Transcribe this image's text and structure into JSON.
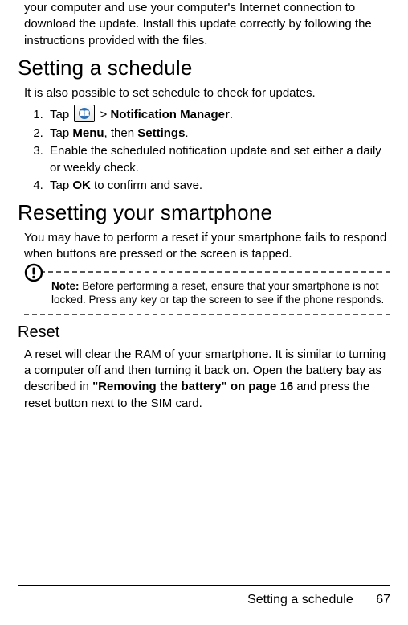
{
  "intro_continuation": "your computer and use your computer's Internet connection to download the update. Install this update correctly by following the instructions provided with the files.",
  "section_schedule": {
    "title": "Setting a schedule",
    "intro": "It is also possible to set schedule to check for updates.",
    "steps": {
      "s1_a": "Tap ",
      "s1_b": " > ",
      "s1_notif": "Notification Manager",
      "s1_c": ".",
      "s2_a": "Tap ",
      "s2_menu": "Menu",
      "s2_b": ", then ",
      "s2_settings": "Settings",
      "s2_c": ".",
      "s3": "Enable the scheduled notification update and set either a daily or weekly check.",
      "s4_a": "Tap ",
      "s4_ok": "OK",
      "s4_b": " to confirm and save."
    }
  },
  "section_reset": {
    "title": "Resetting your smartphone",
    "intro": "You may have to perform a reset if your smartphone fails to respond when buttons are pressed or the screen is tapped.",
    "note_label": "Note:",
    "note_body": " Before performing a reset, ensure that your smartphone is not locked. Press any key or tap the screen to see if the phone responds.",
    "sub_title": "Reset",
    "sub_body_a": "A reset will clear the RAM of your smartphone. It is similar to turning a computer off and then turning it back on. Open the battery bay as described in ",
    "sub_body_ref": "\"Removing the battery\" on page 16",
    "sub_body_b": " and press the reset button next to the SIM card."
  },
  "footer": {
    "title": "Setting a schedule",
    "page": "67"
  }
}
